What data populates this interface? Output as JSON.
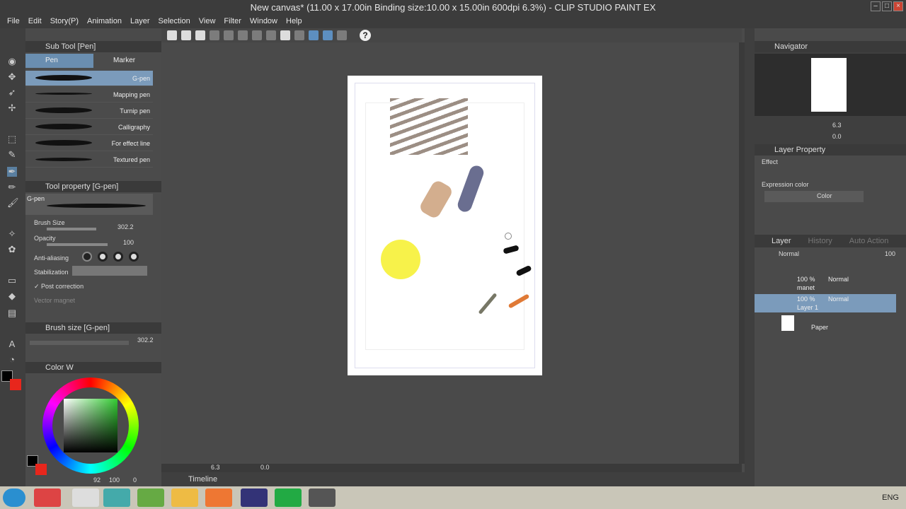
{
  "window": {
    "title": "New canvas* (11.00 x 17.00in Binding size:10.00 x 15.00in 600dpi 6.3%) - CLIP STUDIO PAINT EX"
  },
  "menu": [
    "File",
    "Edit",
    "Story(P)",
    "Animation",
    "Layer",
    "Selection",
    "View",
    "Filter",
    "Window",
    "Help"
  ],
  "subtool": {
    "title": "Sub Tool [Pen]",
    "tabs": [
      "Pen",
      "Marker"
    ],
    "pens": [
      "G-pen",
      "Mapping pen",
      "Turnip pen",
      "Calligraphy",
      "For effect line",
      "Textured pen"
    ]
  },
  "toolprop": {
    "title": "Tool property [G-pen]",
    "preview_label": "G-pen",
    "brush_size_label": "Brush Size",
    "brush_size_value": "302.2",
    "opacity_label": "Opacity",
    "opacity_value": "100",
    "antialias_label": "Anti-aliasing",
    "stabilization_label": "Stabilization",
    "post_correction_label": "Post correction",
    "vector_magnet_label": "Vector magnet"
  },
  "brushsize": {
    "title": "Brush size [G-pen]",
    "value": "302.2"
  },
  "color": {
    "title": "Color W",
    "readout_1": "92",
    "readout_2": "100",
    "readout_3": "0",
    "main": "#000000",
    "sub": "#e8261c"
  },
  "navigator": {
    "title": "Navigator",
    "zoom": "6.3",
    "angle": "0.0"
  },
  "layerprop": {
    "title": "Layer Property",
    "effect_label": "Effect",
    "expression_label": "Expression color",
    "expression_value": "Color"
  },
  "layers": {
    "tabs": [
      "Layer",
      "History",
      "Auto Action"
    ],
    "blend": "Normal",
    "opacity": "100",
    "items": [
      {
        "pct": "100 %",
        "mode": "Normal",
        "name": "manet"
      },
      {
        "pct": "100 %",
        "mode": "Normal",
        "name": "Layer 1"
      },
      {
        "pct": "",
        "mode": "",
        "name": "Paper"
      }
    ]
  },
  "statusbar": {
    "zoom": "6.3",
    "angle": "0.0"
  },
  "timeline": {
    "title": "Timeline"
  },
  "taskbar": {
    "lang": "ENG"
  }
}
